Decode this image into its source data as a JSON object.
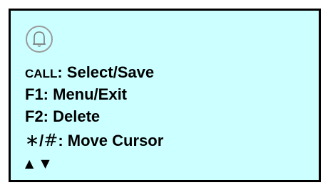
{
  "colors": {
    "panel_background": "#ccffff",
    "border": "#000000",
    "text": "#000000"
  },
  "icon": "bell-icon",
  "lines": {
    "call": {
      "key": "CALL",
      "sep": ": ",
      "desc": "Select/Save"
    },
    "f1": {
      "text": "F1: Menu/Exit"
    },
    "f2": {
      "text": "F2: Delete"
    },
    "cursor": {
      "star": "∗",
      "slash": "/",
      "hash": "#",
      "desc": ": Move Cursor"
    }
  },
  "arrows": {
    "up": "▲",
    "down": "▼"
  }
}
